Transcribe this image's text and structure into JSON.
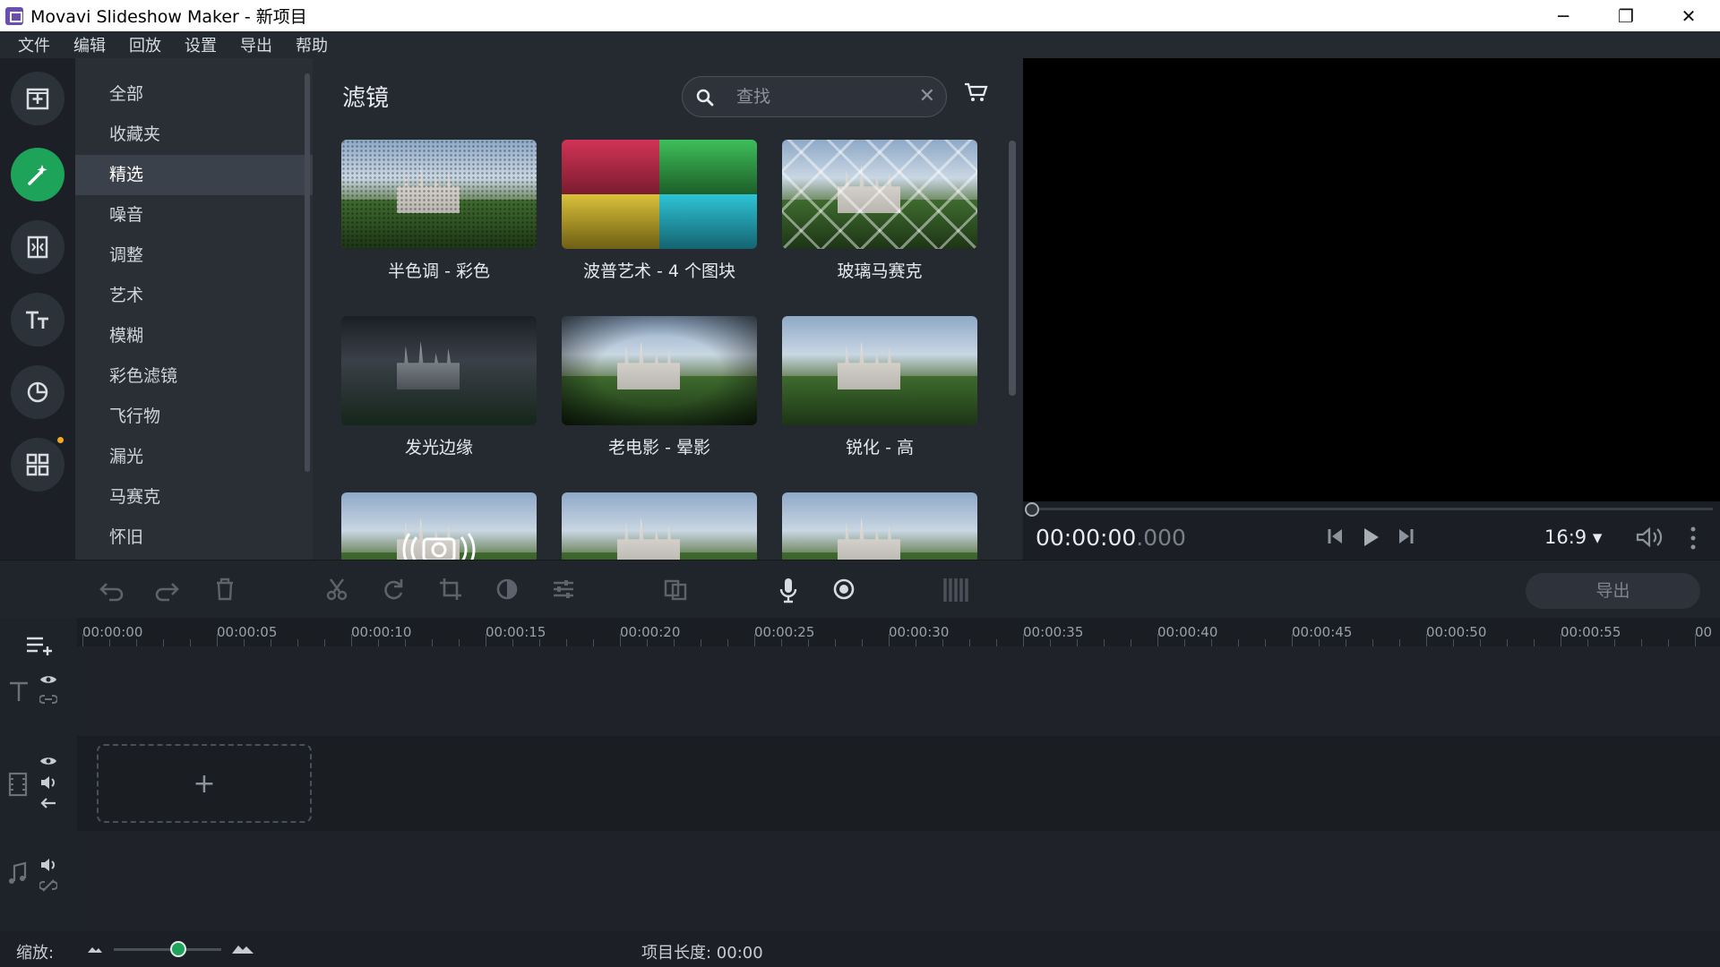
{
  "window": {
    "title": "Movavi Slideshow Maker - 新项目",
    "minimize": "─",
    "restore": "❐",
    "close": "✕"
  },
  "menu": [
    "文件",
    "编辑",
    "回放",
    "设置",
    "导出",
    "帮助"
  ],
  "rail": {
    "items": [
      "import-media",
      "filters",
      "transitions",
      "titles",
      "stickers",
      "more-tools"
    ],
    "active": "filters"
  },
  "categories": {
    "items": [
      "全部",
      "收藏夹",
      "精选",
      "噪音",
      "调整",
      "艺术",
      "模糊",
      "彩色滤镜",
      "飞行物",
      "漏光",
      "马赛克",
      "怀旧"
    ],
    "active_index": 2
  },
  "filters_panel": {
    "title": "滤镜",
    "search_placeholder": "查找",
    "tiles": [
      {
        "label": "半色调 - 彩色",
        "style": "halftone"
      },
      {
        "label": "波普艺术 - 4 个图块",
        "style": "pop"
      },
      {
        "label": "玻璃马赛克",
        "style": "glass"
      },
      {
        "label": "发光边缘",
        "style": "glow"
      },
      {
        "label": "老电影 - 晕影",
        "style": "vignette"
      },
      {
        "label": "锐化 - 高",
        "style": "sharp"
      },
      {
        "label": "",
        "style": "camera"
      },
      {
        "label": "",
        "style": "plain"
      },
      {
        "label": "",
        "style": "plain"
      }
    ]
  },
  "player": {
    "timecode_main": "00:00:00",
    "timecode_ms": ".000",
    "aspect": "16:9 ▾"
  },
  "toolbar": {
    "export_label": "导出"
  },
  "timeline": {
    "ticks": [
      "00:00:00",
      "00:00:05",
      "00:00:10",
      "00:00:15",
      "00:00:20",
      "00:00:25",
      "00:00:30",
      "00:00:35",
      "00:00:40",
      "00:00:45",
      "00:00:50",
      "00:00:55",
      "00"
    ],
    "add_clip": "+"
  },
  "bottom": {
    "zoom_label": "缩放:",
    "project_length": "项目长度: 00:00"
  },
  "colors": {
    "accent": "#1ea35a",
    "background": "#1e2229",
    "notification_dot": "#f5a623"
  }
}
